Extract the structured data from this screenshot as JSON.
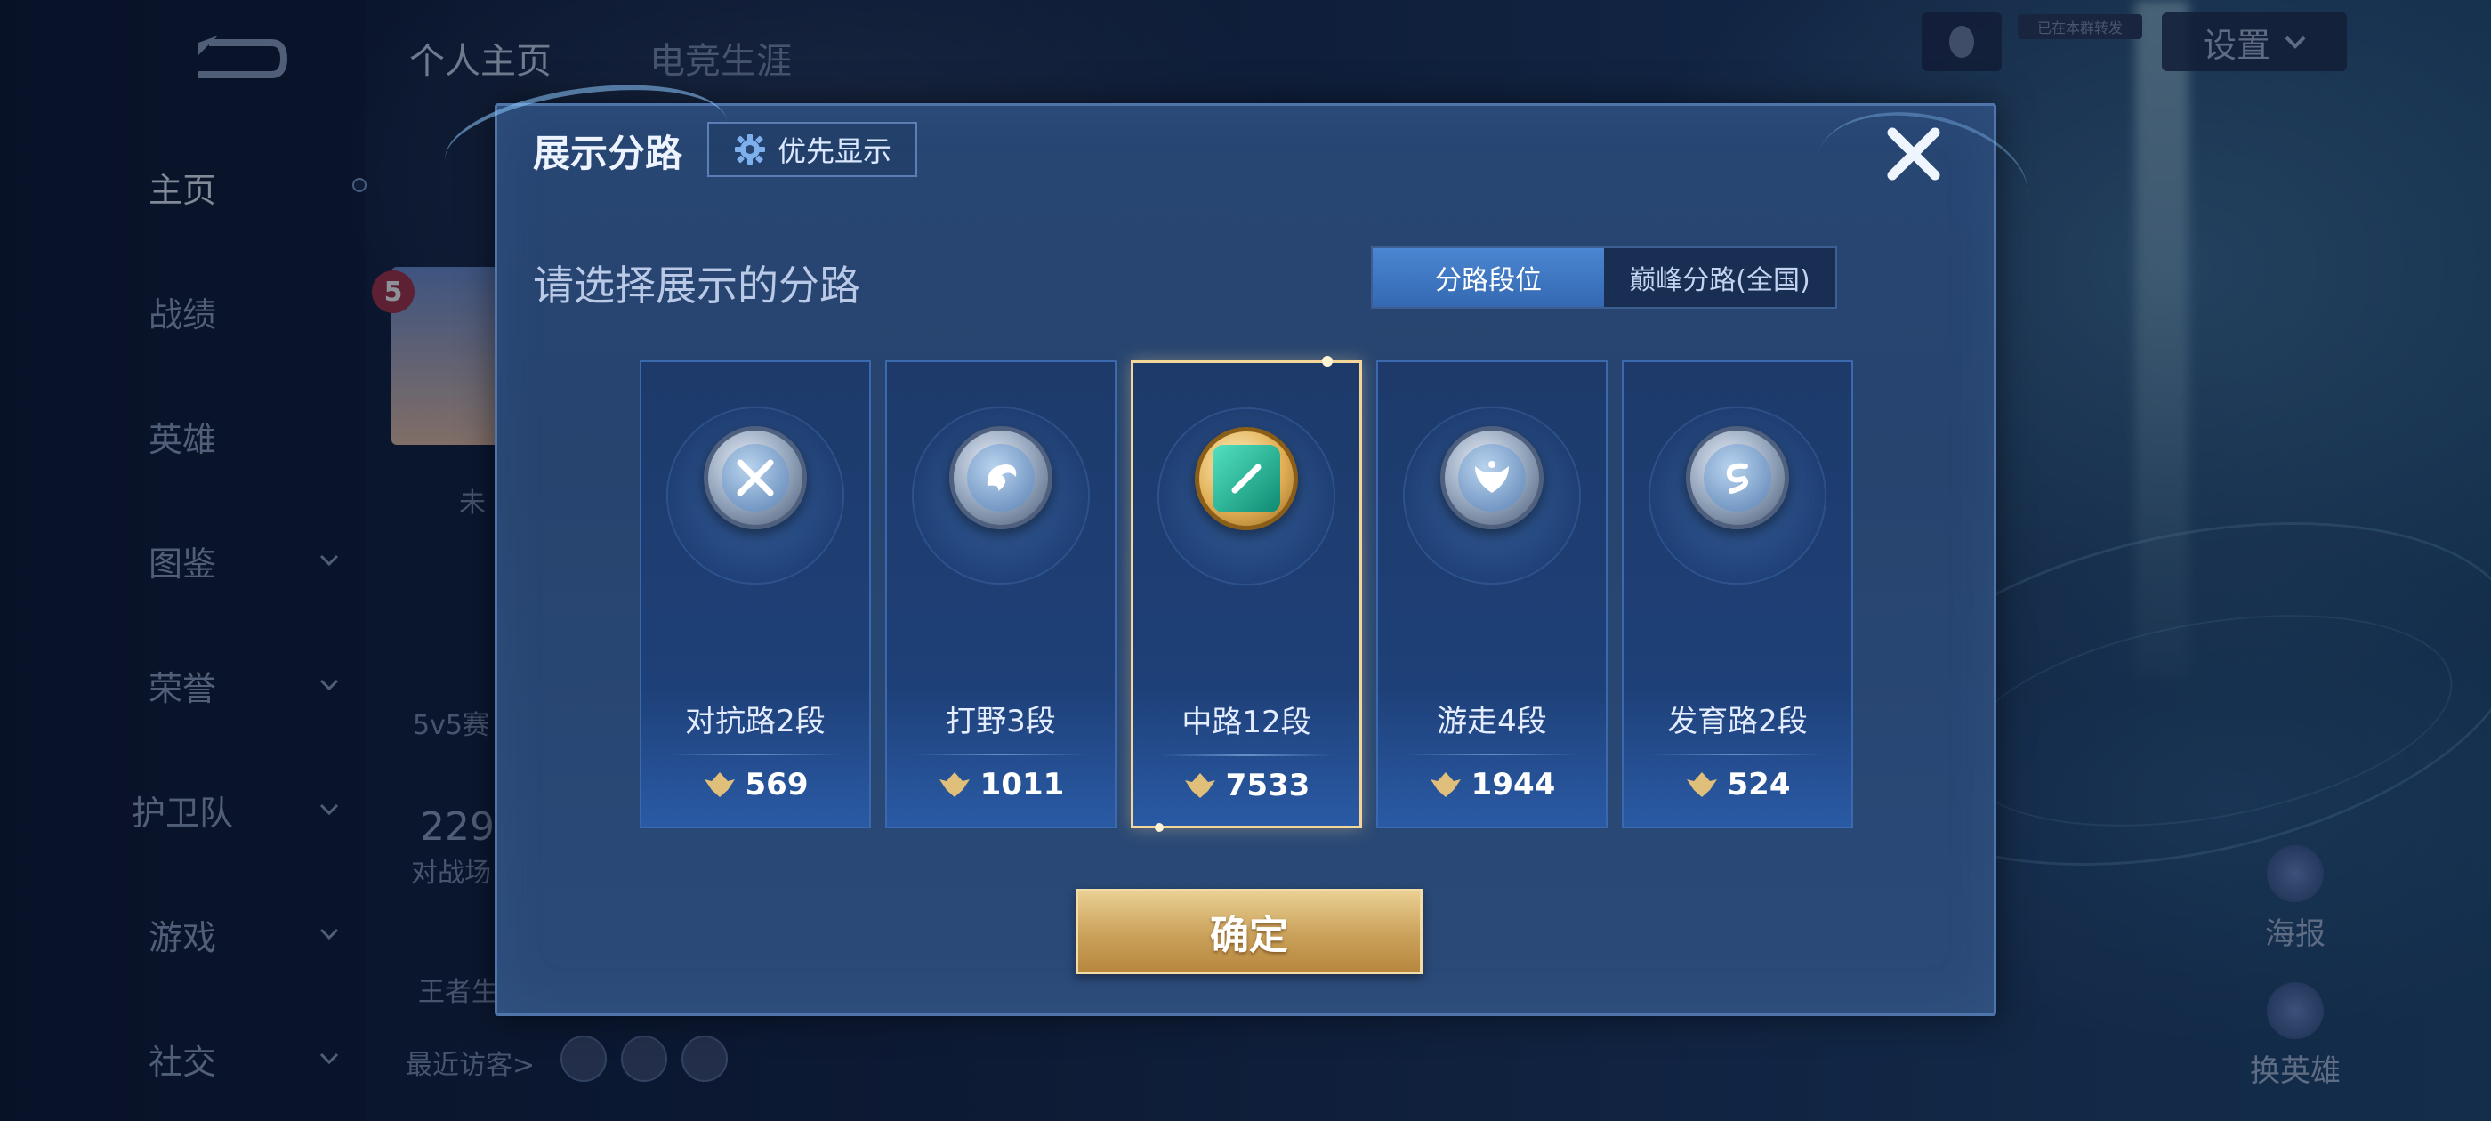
{
  "sidebar": {
    "items": [
      {
        "label": "主页",
        "active": true,
        "has_chevron": false
      },
      {
        "label": "战绩",
        "active": false,
        "has_chevron": false
      },
      {
        "label": "英雄",
        "active": false,
        "has_chevron": false
      },
      {
        "label": "图鉴",
        "active": false,
        "has_chevron": true
      },
      {
        "label": "荣誉",
        "active": false,
        "has_chevron": true
      },
      {
        "label": "护卫队",
        "active": false,
        "has_chevron": true
      },
      {
        "label": "游戏",
        "active": false,
        "has_chevron": true
      },
      {
        "label": "社交",
        "active": false,
        "has_chevron": true
      }
    ]
  },
  "background_page": {
    "tabs": [
      "个人主页",
      "电竞生涯"
    ],
    "level": "5",
    "partial_texts": {
      "status": "未",
      "mode": "5v5赛",
      "count": "229",
      "battle": "对战场",
      "king": "王者生"
    },
    "recent_visitors_label": "最近访客>",
    "settings_label": "设置",
    "qq_tag": "已在本群转发",
    "side_actions": [
      "海报",
      "换英雄"
    ]
  },
  "modal": {
    "title": "展示分路",
    "priority_button": "优先显示",
    "subtitle": "请选择展示的分路",
    "segment": {
      "options": [
        "分路段位",
        "巅峰分路(全国)"
      ],
      "selected": "分路段位"
    },
    "lanes": [
      {
        "name": "对抗路2段",
        "score": "569",
        "emblem": "clash-lane-emblem",
        "selected": false
      },
      {
        "name": "打野3段",
        "score": "1011",
        "emblem": "jungle-emblem",
        "selected": false
      },
      {
        "name": "中路12段",
        "score": "7533",
        "emblem": "mid-lane-emblem",
        "selected": true
      },
      {
        "name": "游走4段",
        "score": "1944",
        "emblem": "roam-emblem",
        "selected": false
      },
      {
        "name": "发育路2段",
        "score": "524",
        "emblem": "farm-lane-emblem",
        "selected": false
      }
    ],
    "confirm_label": "确定"
  },
  "colors": {
    "accent_blue": "#3d78c6",
    "gold": "#caa15a",
    "selected_border": "#f3d79a"
  }
}
